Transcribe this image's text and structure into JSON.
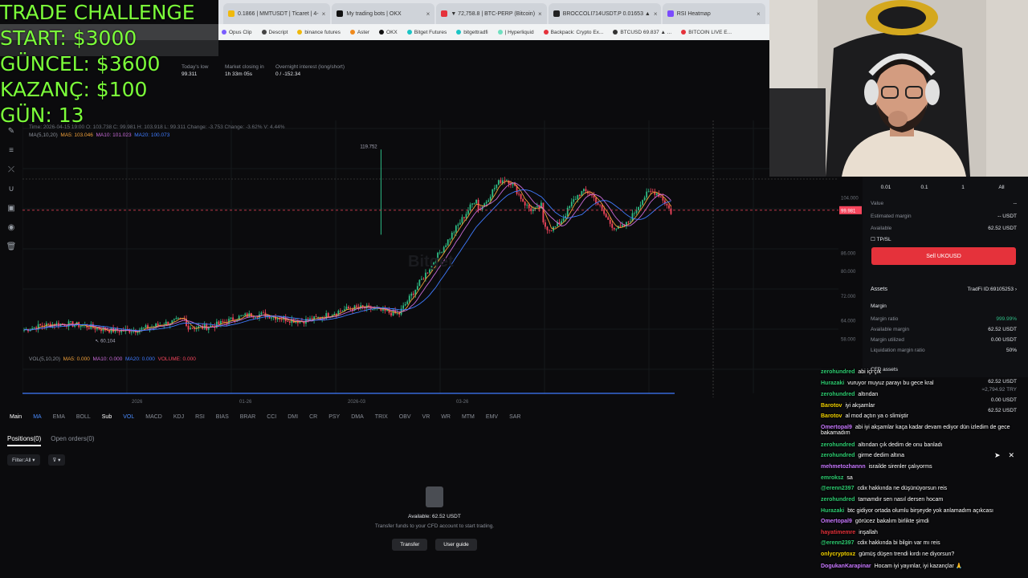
{
  "overlay": {
    "line1": "TRADE CHALLENGE",
    "line2": "START: $3000",
    "line3": "GÜNCEL: $3600",
    "line4": "KAZANÇ: $100",
    "line5": "GÜN: 13"
  },
  "browser": {
    "tabs": [
      {
        "label": "0.1866 | MMTUSDT | Ticaret | 4-",
        "color": "#f0b90b"
      },
      {
        "label": "My trading bots | OKX",
        "color": "#111111"
      },
      {
        "label": "▼ 72,758.8 | BTC-PERP (Bitcoin)",
        "color": "#e5323b"
      },
      {
        "label": "BROCCOLI714USDT.P 0.01653 ▲",
        "color": "#222222"
      },
      {
        "label": "RSI Heatmap",
        "color": "#7b4bff"
      }
    ],
    "bookmarks": [
      {
        "label": "Opus Clip",
        "color": "#7a5cff"
      },
      {
        "label": "Descript",
        "color": "#444444"
      },
      {
        "label": "binance futures",
        "color": "#f0b90b"
      },
      {
        "label": "Aster",
        "color": "#f08a1c"
      },
      {
        "label": "OKX",
        "color": "#111111"
      },
      {
        "label": "Bitget Futures",
        "color": "#1bc5c5"
      },
      {
        "label": "bitgettradfi",
        "color": "#1bc5c5"
      },
      {
        "label": "| Hyperliquid",
        "color": "#6fe0c0"
      },
      {
        "label": "Backpack: Crypto Ex...",
        "color": "#e5323b"
      },
      {
        "label": "BTCUSD 69.837 ▲ ...",
        "color": "#333333"
      },
      {
        "label": "BITCOIN LIVE E...",
        "color": "#e5323b"
      }
    ]
  },
  "ticker": {
    "low_label": "Today's low",
    "low_value": "99.311",
    "close_label": "Market closing in",
    "close_value": "1h 33m 05s",
    "oi_label": "Overnight interest (long/short)",
    "oi_value": "0 / -152.34"
  },
  "chart_data": {
    "type": "candlestick",
    "symbol": "UKOUSD",
    "x_tick_labels": [
      "2026",
      "01-26",
      "2026-03",
      "03-26"
    ],
    "y_tick_labels": [
      "104.000",
      "99.981",
      "86.000",
      "80.000",
      "72.000",
      "64.000",
      "58.000"
    ],
    "annotations": {
      "high": "119.752",
      "low": "60.104",
      "current_price": "99.981"
    },
    "info_line": "Time: 2026-04-15 19:00   O: 103.738   C: 99.981   H: 103.918   L: 99.311   Change: -3.753   Change: -3.62%   V: 4.44%",
    "ma_line": {
      "label": "MA(5,10,20)",
      "ma5": "MA5: 103.046",
      "ma10": "MA10: 101.023",
      "ma20": "MA20: 100.073"
    },
    "vol_line": {
      "label": "VOL(5,10,20)",
      "ma5": "MA5: 0.000",
      "ma10": "MA10: 0.000",
      "ma20": "MA20: 0.000",
      "volume": "VOLUME: 0.000"
    },
    "colors": {
      "up": "#2ebd85",
      "down": "#f6465d",
      "ma5": "#f0a03a",
      "ma10": "#c86bd8",
      "ma20": "#3f7bff"
    }
  },
  "indicators": {
    "main_label": "Main",
    "main_items": [
      "MA",
      "EMA",
      "BOLL"
    ],
    "sub_label": "Sub",
    "sub_items": [
      "VOL",
      "MACD",
      "KDJ",
      "RSI",
      "BIAS",
      "BRAR",
      "CCI",
      "DMI",
      "CR",
      "PSY",
      "DMA",
      "TRIX",
      "OBV",
      "VR",
      "WR",
      "MTM",
      "EMV",
      "SAR"
    ]
  },
  "positions": {
    "tab_positions": "Positions(0)",
    "tab_orders": "Open orders(0)",
    "filter": "Filter:All ▾",
    "filter2": "▾",
    "empty_available": "Available: 62.52 USDT",
    "empty_hint": "Transfer funds to your CFD account to start trading.",
    "transfer_btn": "Transfer",
    "guide_btn": "User guide"
  },
  "order_panel": {
    "qty": [
      "0.01",
      "0.1",
      "1",
      "All"
    ],
    "value_label": "Value",
    "value_val": "--",
    "est_margin_label": "Estimated margin",
    "est_margin_val": "-- USDT",
    "available_label": "Available",
    "available_val": "62.52 USDT",
    "tpsl": "TP/SL",
    "sell_btn": "Sell UKOUSD",
    "assets_title": "Assets",
    "tradfi_id": "TradFi ID:69105253 ›",
    "margin_title": "Margin",
    "margin_ratio_label": "Margin ratio",
    "margin_ratio_val": "999.99%",
    "avail_margin_label": "Available margin",
    "avail_margin_val": "62.52 USDT",
    "margin_util_label": "Margin utilized",
    "margin_util_val": "0.00 USDT",
    "liq_label": "Liquidation margin ratio",
    "liq_val": "50%",
    "cfd_assets": "CFD assets",
    "cfd_val": "62.52 USDT",
    "cfd_try": "≈2,794.92 TRY",
    "pnl_val": "0.00 USDT",
    "equity_val": "62.52 USDT"
  },
  "chat": [
    {
      "user": "zerohundred",
      "color": "#2ecc71",
      "text": "abi içi çık"
    },
    {
      "user": "Hurazaki",
      "color": "#2ecc71",
      "text": "vuruyor muyuz parayı bu gece kral"
    },
    {
      "user": "zerohundred",
      "color": "#2ecc71",
      "text": "altından"
    },
    {
      "user": "Barotov",
      "color": "#f0d000",
      "text": "iyi akşamlar"
    },
    {
      "user": "Barotov",
      "color": "#f0d000",
      "text": "al mod açtın ya o slimiştir"
    },
    {
      "user": "Omertopal9",
      "color": "#c878ff",
      "text": "abi iyi akşamlar kaça kadar devam ediyor dün izledim de gece bakamadım"
    },
    {
      "user": "zerohundred",
      "color": "#2ecc71",
      "text": "altından çık dedim de onu banladı"
    },
    {
      "user": "zerohundred",
      "color": "#2ecc71",
      "text": "girme dedim altına"
    },
    {
      "user": "mehmetozhannn",
      "color": "#c878ff",
      "text": "israilde sirenler çalıyorms"
    },
    {
      "user": "emroksz",
      "color": "#2ecc71",
      "text": "sa"
    },
    {
      "user": "@erenn2397",
      "color": "#2ecc71",
      "text": "cdix hakkında ne düşünüyorsun reis"
    },
    {
      "user": "zerohundred",
      "color": "#2ecc71",
      "text": "tamamdır sen nasıl dersen hocam"
    },
    {
      "user": "Hurazaki",
      "color": "#2ecc71",
      "text": "btc gidiyor ortada olumlu birşeyde yok anlamadım açıkcası"
    },
    {
      "user": "Omertopal9",
      "color": "#c878ff",
      "text": "görücez bakalım birlikte şimdi"
    },
    {
      "user": "hayatimemre",
      "color": "#e5323b",
      "text": "inşallah"
    },
    {
      "user": "@erenn2397",
      "color": "#2ecc71",
      "text": "cdix hakkında bi bilgin var mı reis"
    },
    {
      "user": "onlycryptoxz",
      "color": "#f0d000",
      "text": "gümüş düşen trendi kırdı ne diyorsun?"
    },
    {
      "user": "DogukanKarapinar",
      "color": "#c878ff",
      "text": "Hocam iyi yayınlar, iyi kazançlar 🙏"
    }
  ]
}
